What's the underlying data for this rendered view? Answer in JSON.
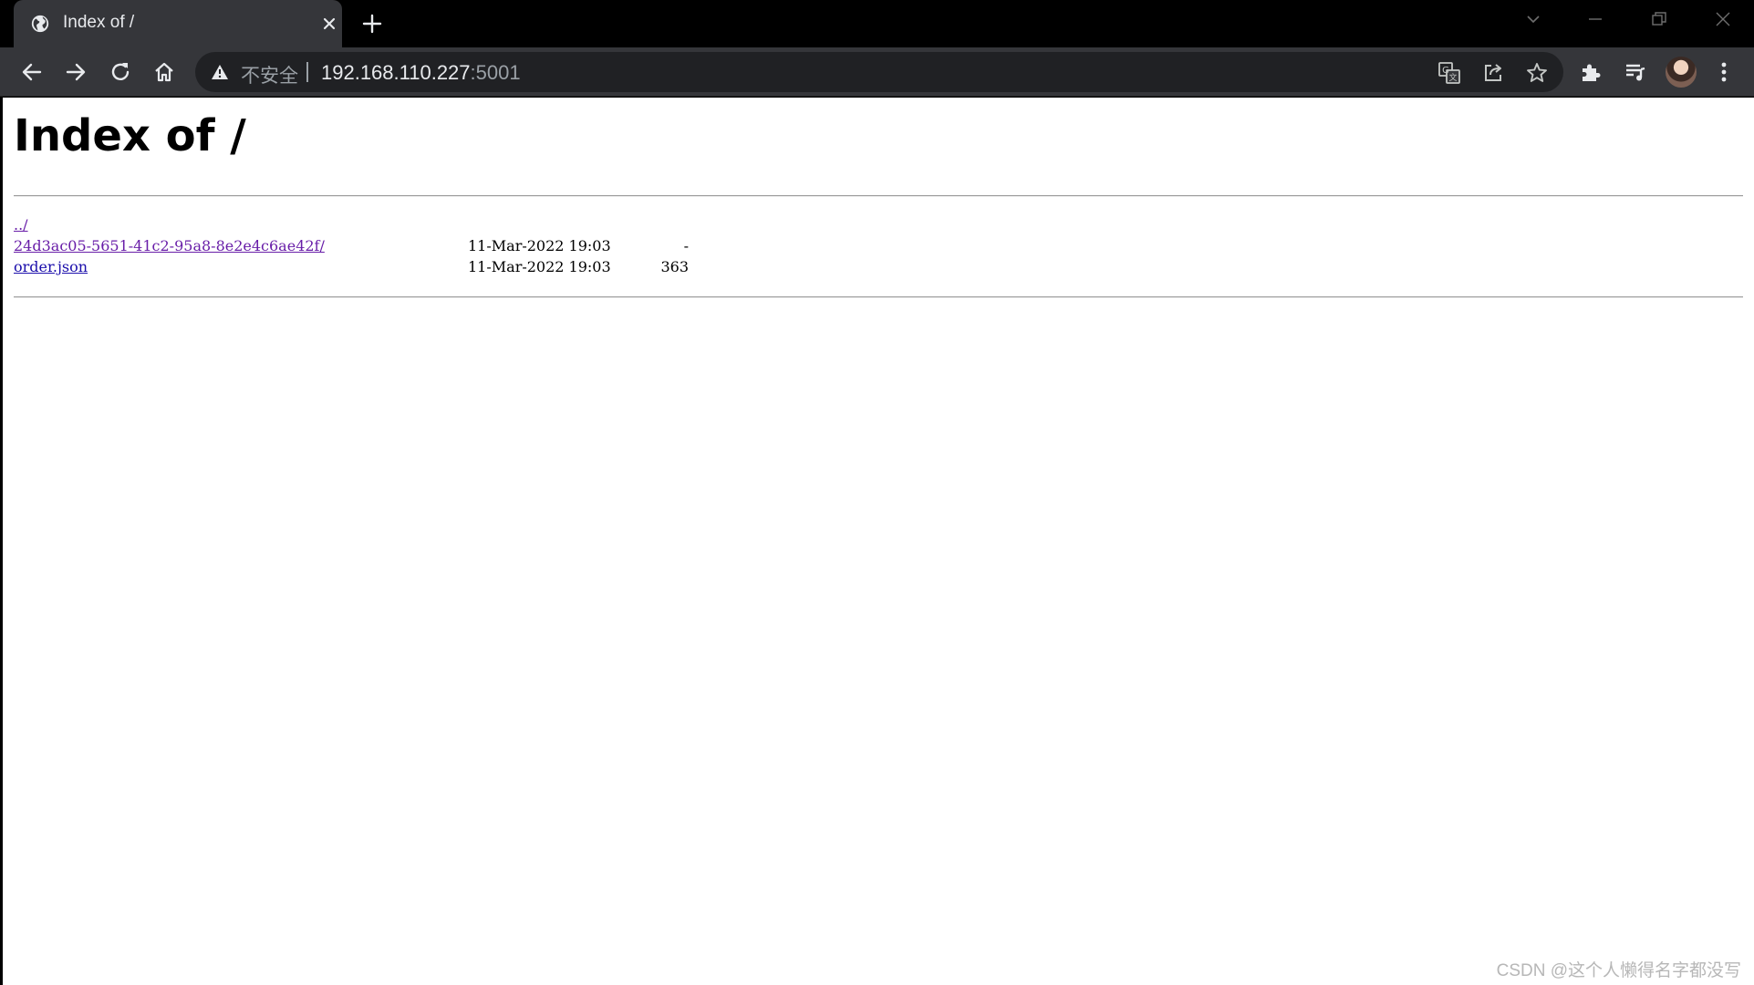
{
  "browser": {
    "tab": {
      "title": "Index of /",
      "favicon": "globe-icon"
    },
    "toolbar": {
      "security_label": "不安全",
      "url_host": "192.168.110.227",
      "url_port": ":5001"
    }
  },
  "page": {
    "heading": "Index of /",
    "entries": [
      {
        "name": "../",
        "date": "",
        "size": "",
        "visited": true
      },
      {
        "name": "24d3ac05-5651-41c2-95a8-8e2e4c6ae42f/",
        "date": "11-Mar-2022 19:03",
        "size": "-",
        "visited": true
      },
      {
        "name": "order.json",
        "date": "11-Mar-2022 19:03",
        "size": "363",
        "visited": false
      }
    ]
  },
  "watermark": "CSDN @这个人懒得名字都没写",
  "colors": {
    "tab_bg": "#35363a",
    "titlebar_bg": "#000000",
    "omnibox_bg": "#202124",
    "link": "#1a0dab",
    "visited_link": "#681da8"
  }
}
